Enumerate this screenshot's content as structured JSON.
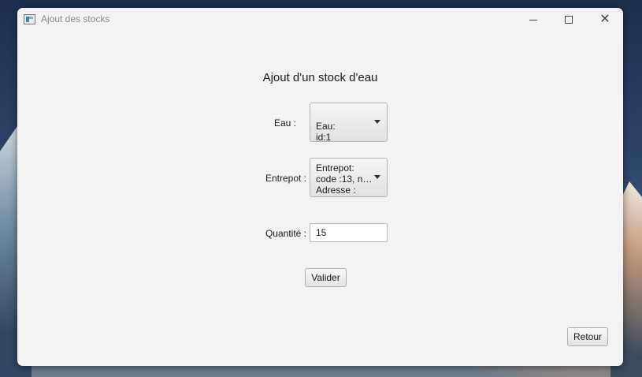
{
  "window": {
    "title": "Ajout des stocks",
    "controls": {
      "minimize_icon": "minimize-icon",
      "maximize_icon": "maximize-icon",
      "close_icon": "close-icon",
      "close_glyph": "✕"
    }
  },
  "form": {
    "title": "Ajout d'un stock d'eau",
    "eau": {
      "label": "Eau :",
      "selected_lines": [
        "Eau:",
        " id:1"
      ]
    },
    "entrepot": {
      "label": "Entrepot :",
      "selected_lines": [
        "Entrepot:",
        " code :13, no...",
        " Adresse :"
      ]
    },
    "quantite": {
      "label": "Quantité :",
      "value": "15"
    },
    "submit_label": "Valider"
  },
  "footer": {
    "back_label": "Retour"
  },
  "colors": {
    "window_bg": "#f3f3f3",
    "text": "#1a1a1a",
    "title_bar_text": "#8a8a8a"
  }
}
